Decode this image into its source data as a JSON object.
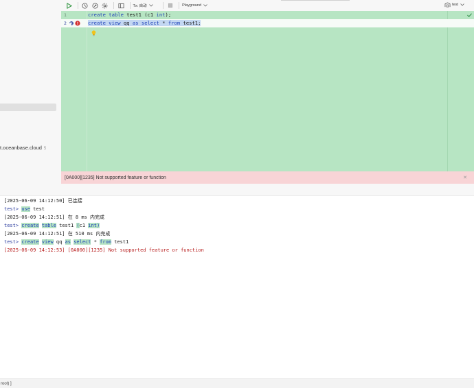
{
  "left_panel": {
    "host_label": "t.oceanbase.cloud",
    "host_count": "5"
  },
  "toolbar": {
    "tx_label": "Tx: 自动",
    "playground_label": "Playground",
    "datasource_label": "test"
  },
  "editor": {
    "lines": [
      {
        "number": "1",
        "text": "create table test1 (c1 int);"
      },
      {
        "number": "2",
        "text": "create view qq as select * from test1;"
      }
    ]
  },
  "error_bar": {
    "message": "[0A000][1235] Not supported feature or function"
  },
  "output": {
    "line1": "[2025-06-09 14:12:50] 已连接",
    "l2_prompt": "test> ",
    "l2_kw": "use",
    "l2_rest": " test",
    "line3": "[2025-06-09 14:12:51] 在 8 ms 内完成",
    "l4_prompt": "test> ",
    "l4_kw1": "create",
    "l4_kw2": "table",
    "l4_mid": " test1 ",
    "l4_paren": "(",
    "l4_col": "c1 ",
    "l4_kw3": "int",
    "l4_end": ")",
    "line5": "[2025-06-09 14:12:51] 在 510 ms 内完成",
    "l6_prompt": "test> ",
    "l6_kw1": "create",
    "l6_kw2": "view",
    "l6_name": " qq ",
    "l6_kw3": "as",
    "l6_kw4": "select",
    "l6_star": " * ",
    "l6_kw5": "from",
    "l6_end": " test1",
    "line7": "[2025-06-09 14:12:53] [0A000][1235] Not supported feature or function"
  },
  "status_bar": {
    "text": "root) ]"
  },
  "colors": {
    "editor_bg": "#b7e5c3",
    "error_bg": "#f8d4d6",
    "keyword": "#1d40b8",
    "error_text": "#b71c1c"
  }
}
